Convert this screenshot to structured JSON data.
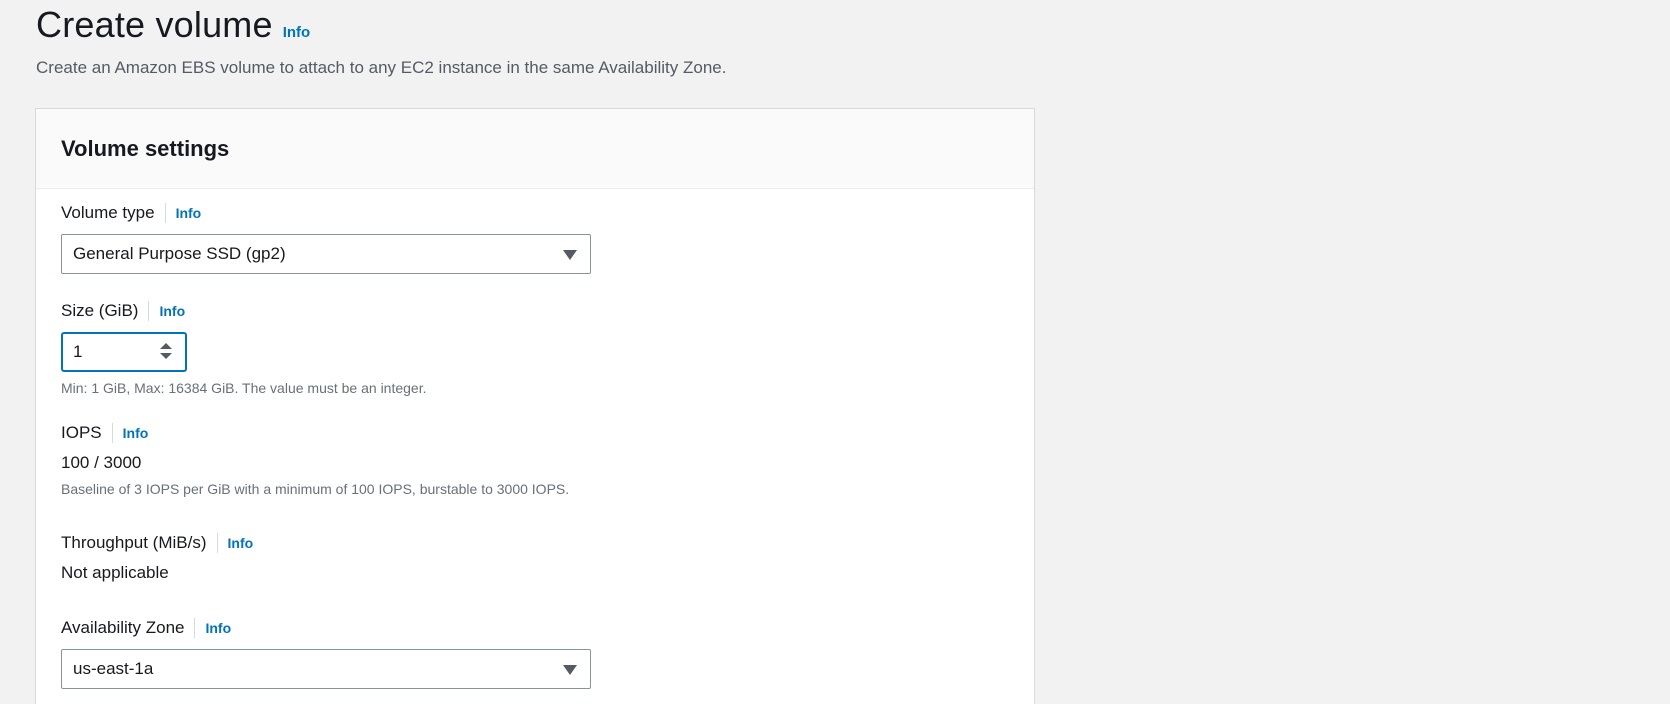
{
  "header": {
    "title": "Create volume",
    "info_label": "Info",
    "description": "Create an Amazon EBS volume to attach to any EC2 instance in the same Availability Zone."
  },
  "panel": {
    "title": "Volume settings"
  },
  "volume_type": {
    "label": "Volume type",
    "info_label": "Info",
    "selected": "General Purpose SSD (gp2)"
  },
  "size": {
    "label": "Size (GiB)",
    "info_label": "Info",
    "value": "1",
    "hint": "Min: 1 GiB, Max: 16384 GiB. The value must be an integer."
  },
  "iops": {
    "label": "IOPS",
    "info_label": "Info",
    "value": "100 / 3000",
    "hint": "Baseline of 3 IOPS per GiB with a minimum of 100 IOPS, burstable to 3000 IOPS."
  },
  "throughput": {
    "label": "Throughput (MiB/s)",
    "info_label": "Info",
    "value": "Not applicable"
  },
  "availability_zone": {
    "label": "Availability Zone",
    "info_label": "Info",
    "selected": "us-east-1a"
  },
  "colors": {
    "link": "#0073bb",
    "background": "#f2f2f2",
    "focus_border": "#0073bb"
  }
}
